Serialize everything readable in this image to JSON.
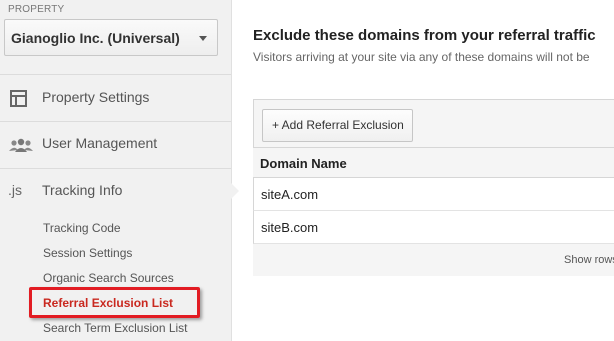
{
  "sidebar": {
    "property_label": "PROPERTY",
    "property_selected": "Gianoglio Inc. (Universal)",
    "items": [
      {
        "label": "Property Settings",
        "icon": "layout-icon"
      },
      {
        "label": "User Management",
        "icon": "users-icon"
      },
      {
        "label": "Tracking Info",
        "icon": "js-icon",
        "icon_text": ".js"
      }
    ],
    "sub_items": [
      {
        "label": "Tracking Code"
      },
      {
        "label": "Session Settings"
      },
      {
        "label": "Organic Search Sources"
      },
      {
        "label": "Referral Exclusion List",
        "active": true
      },
      {
        "label": "Search Term Exclusion List"
      }
    ]
  },
  "main": {
    "title": "Exclude these domains from your referral traffic",
    "subtitle": "Visitors arriving at your site via any of these domains will not be",
    "add_button": "+ Add Referral Exclusion",
    "table": {
      "columns": [
        "Domain Name"
      ],
      "rows": [
        [
          "siteA.com"
        ],
        [
          "siteB.com"
        ]
      ]
    },
    "footer_show": "Show rows"
  },
  "colors": {
    "active_red": "#c9281f",
    "highlight_border": "#e21c23",
    "sidebar_bg": "#f1f1f1"
  }
}
